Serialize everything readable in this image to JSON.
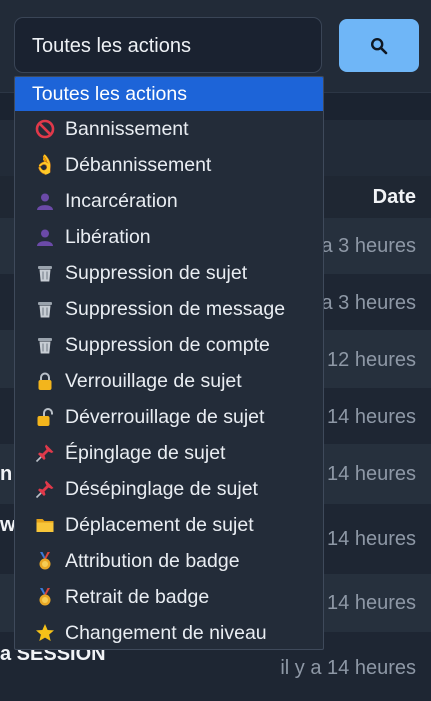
{
  "filter": {
    "selected_value": "Toutes les actions"
  },
  "search_button": {
    "icon": "search-icon"
  },
  "table": {
    "date_header": "Date",
    "rows": [
      {
        "time": "a 3 heures",
        "label": ""
      },
      {
        "time": "a 3 heures",
        "label": ""
      },
      {
        "time": "12 heures",
        "label": ""
      },
      {
        "time": "14 heures",
        "label": ""
      },
      {
        "time": "14 heures",
        "label": "n"
      },
      {
        "time": "14 heures",
        "label": "w"
      },
      {
        "time": "14 heures",
        "label": ""
      },
      {
        "time": "il y a 14 heures",
        "label": "a SESSION"
      }
    ]
  },
  "dropdown": {
    "options": [
      {
        "label": "Toutes les actions",
        "icon": "",
        "selected": true
      },
      {
        "label": "Bannissement",
        "icon": "no-entry-icon"
      },
      {
        "label": "Débannissement",
        "icon": "ok-hand-icon"
      },
      {
        "label": "Incarcération",
        "icon": "silhouette-icon"
      },
      {
        "label": "Libération",
        "icon": "silhouette-icon"
      },
      {
        "label": "Suppression de sujet",
        "icon": "trash-icon"
      },
      {
        "label": "Suppression de message",
        "icon": "trash-icon"
      },
      {
        "label": "Suppression de compte",
        "icon": "trash-icon"
      },
      {
        "label": "Verrouillage de sujet",
        "icon": "lock-icon"
      },
      {
        "label": "Déverrouillage de sujet",
        "icon": "unlock-icon"
      },
      {
        "label": "Épinglage de sujet",
        "icon": "pin-icon"
      },
      {
        "label": "Désépinglage de sujet",
        "icon": "pin-icon"
      },
      {
        "label": "Déplacement de sujet",
        "icon": "folder-icon"
      },
      {
        "label": "Attribution de badge",
        "icon": "medal-icon"
      },
      {
        "label": "Retrait de badge",
        "icon": "medal-icon"
      },
      {
        "label": "Changement de niveau",
        "icon": "star-icon"
      }
    ]
  },
  "colors": {
    "accent_selected": "#1d64d8",
    "search_button": "#6fb6f7",
    "background": "#1b2330"
  }
}
